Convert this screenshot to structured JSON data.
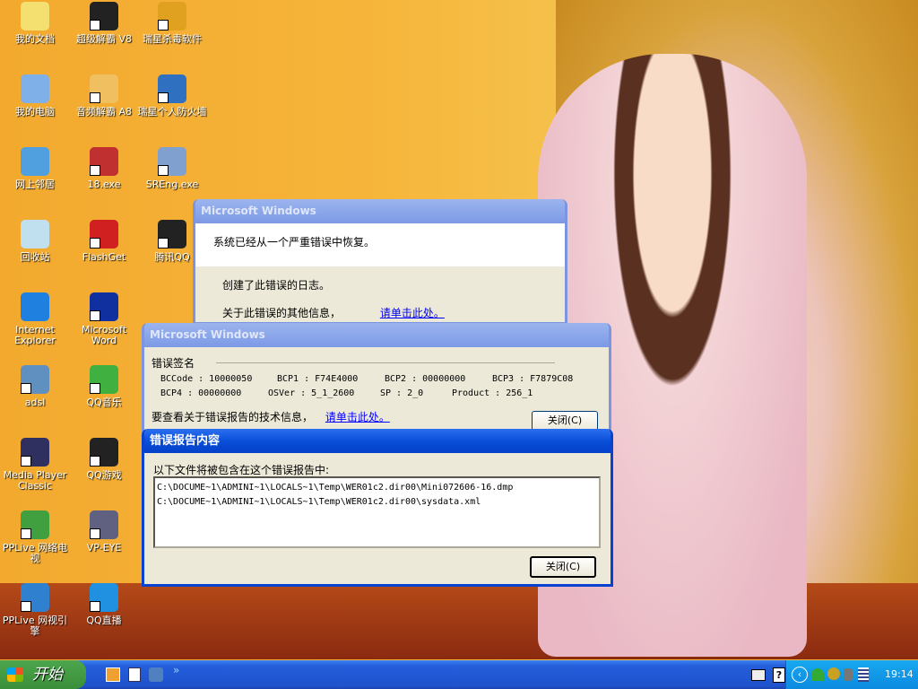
{
  "desktop": {
    "icons": [
      {
        "label": "我的文档",
        "color": "#f4e070",
        "shortcut": false
      },
      {
        "label": "超级解霸 V8",
        "color": "#222",
        "shortcut": true
      },
      {
        "label": "瑞星杀毒软件",
        "color": "#e0a020",
        "shortcut": true
      },
      {
        "label": "我的电脑",
        "color": "#7fb0e8",
        "shortcut": false
      },
      {
        "label": "音频解霸 A8",
        "color": "#f0c060",
        "shortcut": true
      },
      {
        "label": "瑞星个人防火墙",
        "color": "#3070c0",
        "shortcut": true
      },
      {
        "label": "网上邻居",
        "color": "#50a0e0",
        "shortcut": false
      },
      {
        "label": "18.exe",
        "color": "#c03030",
        "shortcut": true
      },
      {
        "label": "SREng.exe",
        "color": "#80a0d0",
        "shortcut": true
      },
      {
        "label": "回收站",
        "color": "#c0e0f0",
        "shortcut": false
      },
      {
        "label": "FlashGet",
        "color": "#d02020",
        "shortcut": true
      },
      {
        "label": "腾讯QQ",
        "color": "#222",
        "shortcut": true
      },
      {
        "label": "Internet Explorer",
        "color": "#2080e0",
        "shortcut": false
      },
      {
        "label": "Microsoft Word",
        "color": "#1030a0",
        "shortcut": true
      },
      {
        "label": "adsl",
        "color": "#6090c0",
        "shortcut": true
      },
      {
        "label": "QQ音乐",
        "color": "#40b040",
        "shortcut": true
      },
      {
        "label": "Media Player Classic",
        "color": "#303060",
        "shortcut": true
      },
      {
        "label": "QQ游戏",
        "color": "#222",
        "shortcut": true
      },
      {
        "label": "PPLive 网络电视",
        "color": "#40a040",
        "shortcut": true
      },
      {
        "label": "VP-EYE",
        "color": "#606080",
        "shortcut": true
      },
      {
        "label": "PPLive 网视引擎",
        "color": "#3080d0",
        "shortcut": true
      },
      {
        "label": "QQ直播",
        "color": "#2090e0",
        "shortcut": true
      }
    ]
  },
  "dialog1": {
    "title": "Microsoft Windows",
    "message": "系统已经从一个严重错误中恢复。",
    "log": "创建了此错误的日志。",
    "more_info": "关于此错误的其他信息，",
    "link": "请单击此处。"
  },
  "dialog2": {
    "title": "Microsoft Windows",
    "section": "错误签名",
    "row1": [
      "BCCode : 10000050",
      "BCP1 : F74E4000",
      "BCP2 : 00000000",
      "BCP3 : F7879C08"
    ],
    "row2": [
      "BCP4 : 00000000",
      "OSVer : 5_1_2600",
      "SP : 2_0",
      "Product : 256_1"
    ],
    "tech_info": "要查看关于错误报告的技术信息，",
    "link": "请单击此处。",
    "close": "关闭(C)"
  },
  "dialog3": {
    "title": "错误报告内容",
    "intro": "以下文件将被包含在这个错误报告中:",
    "files": [
      "C:\\DOCUME~1\\ADMINI~1\\LOCALS~1\\Temp\\WER01c2.dir00\\Mini072606-16.dmp",
      "C:\\DOCUME~1\\ADMINI~1\\LOCALS~1\\Temp\\WER01c2.dir00\\sysdata.xml"
    ],
    "close": "关闭(C)"
  },
  "taskbar": {
    "start": "开始",
    "quicklaunch_more": "»",
    "clock": "19:14"
  }
}
